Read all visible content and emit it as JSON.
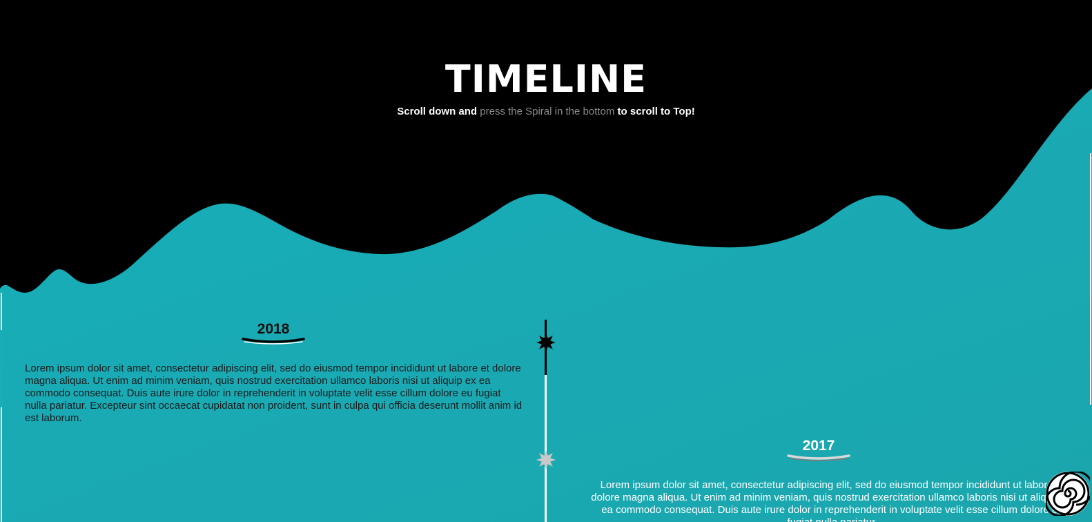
{
  "header": {
    "title": "TIMELINE",
    "subtitle_part1": "Scroll down and ",
    "subtitle_part2": "press the Spiral in the bottom",
    "subtitle_part3": " to scroll to Top!"
  },
  "timeline": {
    "entries": [
      {
        "year": "2018",
        "text": "Lorem ipsum dolor sit amet, consectetur adipiscing elit, sed do eiusmod tempor incididunt ut labore et dolore magna aliqua. Ut enim ad minim veniam, quis nostrud exercitation ullamco laboris nisi ut aliquip ex ea commodo consequat. Duis aute irure dolor in reprehenderit in voluptate velit esse cillum dolore eu fugiat nulla pariatur. Excepteur sint occaecat cupidatat non proident, sunt in culpa qui officia deserunt mollit anim id est laborum."
      },
      {
        "year": "2017",
        "text": "Lorem ipsum dolor sit amet, consectetur adipiscing elit, sed do eiusmod tempor incididunt ut labore et dolore magna aliqua. Ut enim ad minim veniam, quis nostrud exercitation ullamco laboris nisi ut aliquip ex ea commodo consequat. Duis aute irure dolor in reprehenderit in voluptate velit esse cillum dolore eu fugiat nulla pariatur."
      }
    ]
  },
  "colors": {
    "background": "#19aeb8",
    "wave": "#000000",
    "accent_dark": "#000000",
    "accent_light": "#ffffff"
  },
  "icons": {
    "axis_marker": "star-burst-icon",
    "scroll_top": "spiral-icon"
  }
}
